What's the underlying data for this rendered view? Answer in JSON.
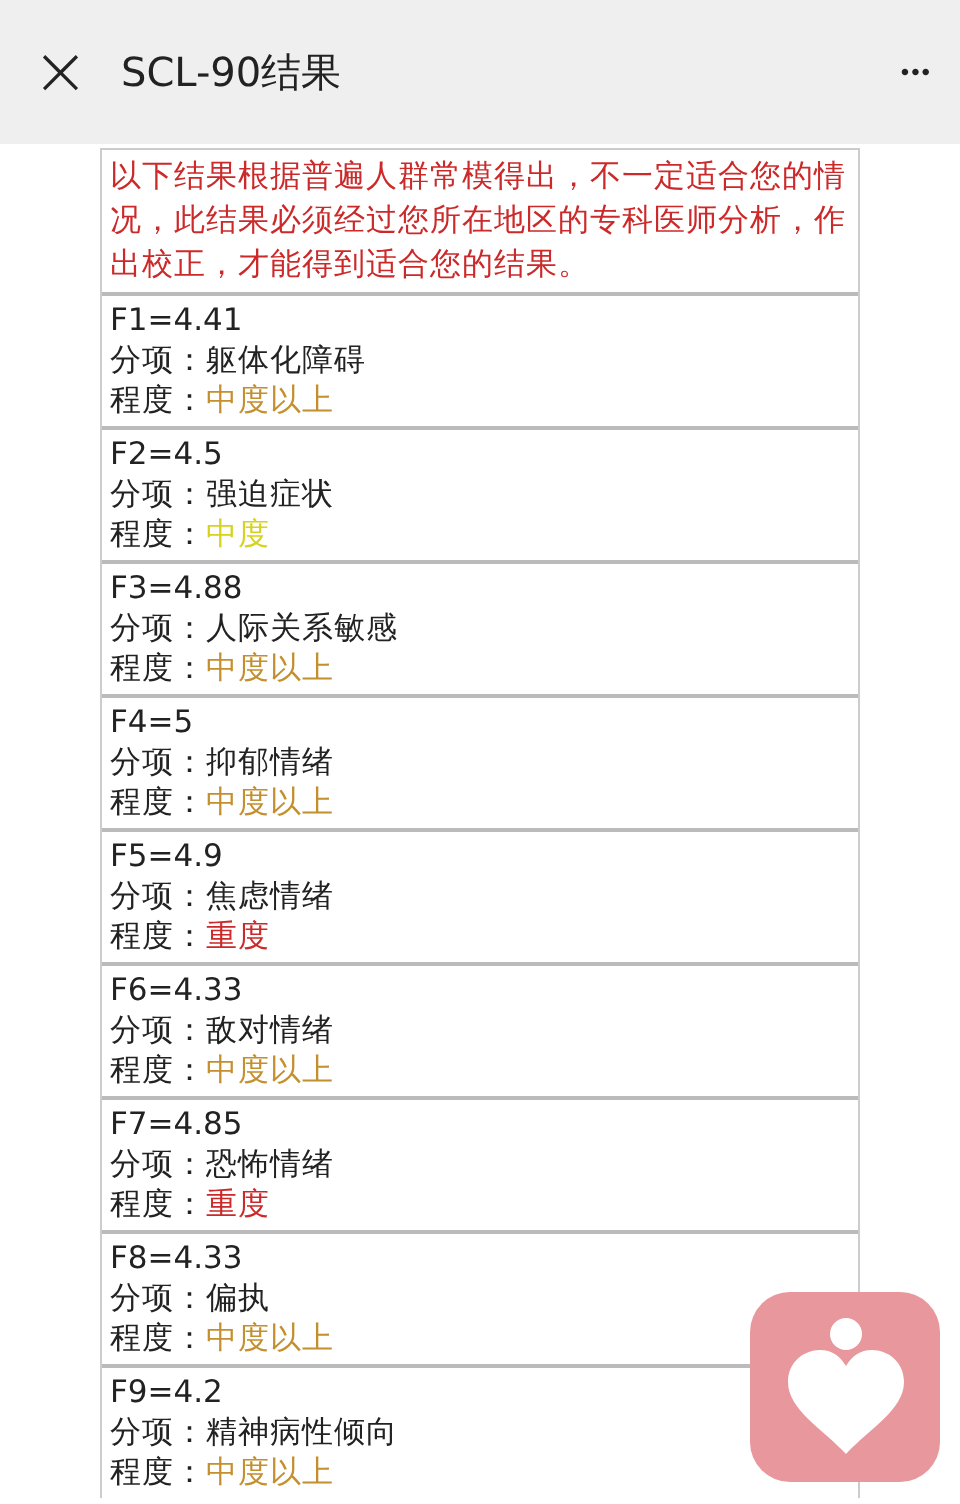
{
  "header": {
    "close": "×",
    "title": "SCL-90结果",
    "more": "•••"
  },
  "notice": "以下结果根据普遍人群常模得出，不一定适合您的情况，此结果必须经过您所在地区的专科医师分析，作出校正，才能得到适合您的结果。",
  "results": [
    {
      "score": "F1=4.41",
      "factor_label": "分项：",
      "factor": "躯体化障碍",
      "degree_label": "程度：",
      "degree": "中度以上",
      "color": "#c4902f"
    },
    {
      "score": "F2=4.5",
      "factor_label": "分项：",
      "factor": "强迫症状",
      "degree_label": "程度：",
      "degree": "中度",
      "color": "#d6d21e"
    },
    {
      "score": "F3=4.88",
      "factor_label": "分项：",
      "factor": "人际关系敏感",
      "degree_label": "程度：",
      "degree": "中度以上",
      "color": "#c4902f"
    },
    {
      "score": "F4=5",
      "factor_label": "分项：",
      "factor": "抑郁情绪",
      "degree_label": "程度：",
      "degree": "中度以上",
      "color": "#c4902f"
    },
    {
      "score": "F5=4.9",
      "factor_label": "分项：",
      "factor": "焦虑情绪",
      "degree_label": "程度：",
      "degree": "重度",
      "color": "#cc2a2a"
    },
    {
      "score": "F6=4.33",
      "factor_label": "分项：",
      "factor": "敌对情绪",
      "degree_label": "程度：",
      "degree": "中度以上",
      "color": "#c4902f"
    },
    {
      "score": "F7=4.85",
      "factor_label": "分项：",
      "factor": "恐怖情绪",
      "degree_label": "程度：",
      "degree": "重度",
      "color": "#cc2a2a"
    },
    {
      "score": "F8=4.33",
      "factor_label": "分项：",
      "factor": "偏执",
      "degree_label": "程度：",
      "degree": "中度以上",
      "color": "#c4902f"
    },
    {
      "score": "F9=4.2",
      "factor_label": "分项：",
      "factor": "精神病性倾向",
      "degree_label": "程度：",
      "degree": "中度以上",
      "color": "#c4902f"
    }
  ]
}
